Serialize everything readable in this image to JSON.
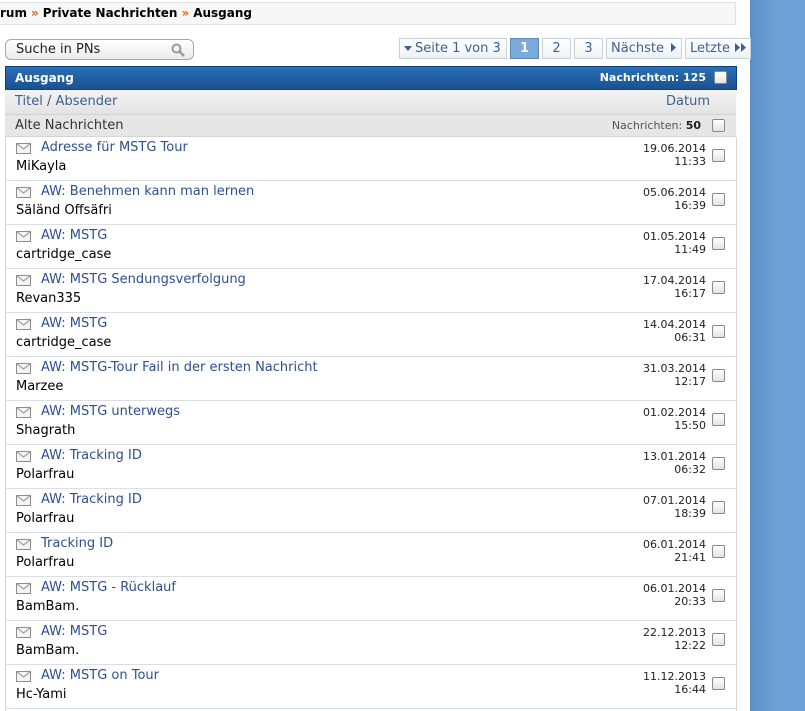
{
  "breadcrumb": {
    "items": [
      "rum",
      "Private Nachrichten",
      "Ausgang"
    ],
    "separator": "»"
  },
  "search": {
    "placeholder": "Suche in PNs"
  },
  "pager": {
    "page_info": "Seite 1 von 3",
    "pages": [
      "1",
      "2",
      "3"
    ],
    "current": "1",
    "next_label": "Nächste",
    "last_label": "Letzte"
  },
  "folder": {
    "title": "Ausgang",
    "count_label": "Nachrichten: 125"
  },
  "columns": {
    "title": "Titel",
    "slash": "/",
    "sender": "Absender",
    "date": "Datum"
  },
  "group": {
    "name": "Alte Nachrichten",
    "count_label": "Nachrichten:",
    "count": "50"
  },
  "messages": [
    {
      "subject": "Adresse für MSTG Tour",
      "sender": "MiKayla",
      "date": "19.06.2014",
      "time": "11:33"
    },
    {
      "subject": "AW: Benehmen kann man lernen",
      "sender": "Säländ Offsäfri",
      "date": "05.06.2014",
      "time": "16:39"
    },
    {
      "subject": "AW: MSTG",
      "sender": "cartridge_case",
      "date": "01.05.2014",
      "time": "11:49"
    },
    {
      "subject": "AW: MSTG Sendungsverfolgung",
      "sender": "Revan335",
      "date": "17.04.2014",
      "time": "16:17"
    },
    {
      "subject": "AW: MSTG",
      "sender": "cartridge_case",
      "date": "14.04.2014",
      "time": "06:31"
    },
    {
      "subject": "AW: MSTG-Tour Fail in der ersten Nachricht",
      "sender": "Marzee",
      "date": "31.03.2014",
      "time": "12:17"
    },
    {
      "subject": "AW: MSTG unterwegs",
      "sender": "Shagrath",
      "date": "01.02.2014",
      "time": "15:50"
    },
    {
      "subject": "AW: Tracking ID",
      "sender": "Polarfrau",
      "date": "13.01.2014",
      "time": "06:32"
    },
    {
      "subject": "AW: Tracking ID",
      "sender": "Polarfrau",
      "date": "07.01.2014",
      "time": "18:39"
    },
    {
      "subject": "Tracking ID",
      "sender": "Polarfrau",
      "date": "06.01.2014",
      "time": "21:41"
    },
    {
      "subject": "AW: MSTG - Rücklauf",
      "sender": "BamBam.",
      "date": "06.01.2014",
      "time": "20:33"
    },
    {
      "subject": "AW: MSTG",
      "sender": "BamBam.",
      "date": "22.12.2013",
      "time": "12:22"
    },
    {
      "subject": "AW: MSTG on Tour",
      "sender": "Hc-Yami",
      "date": "11.12.2013",
      "time": "16:44"
    }
  ],
  "icons": {
    "search": "magnifier-icon",
    "message": "envelope-icon",
    "prev": "triangle-down-icon",
    "next": "triangle-right-icon",
    "last": "double-triangle-right-icon"
  },
  "colors": {
    "header_blue": "#1b5290",
    "link_blue": "#2e4f8f",
    "page_active": "#7ba9d9",
    "breadcrumb_sep": "#d5651a",
    "side_bg": "#6ea2d6"
  }
}
